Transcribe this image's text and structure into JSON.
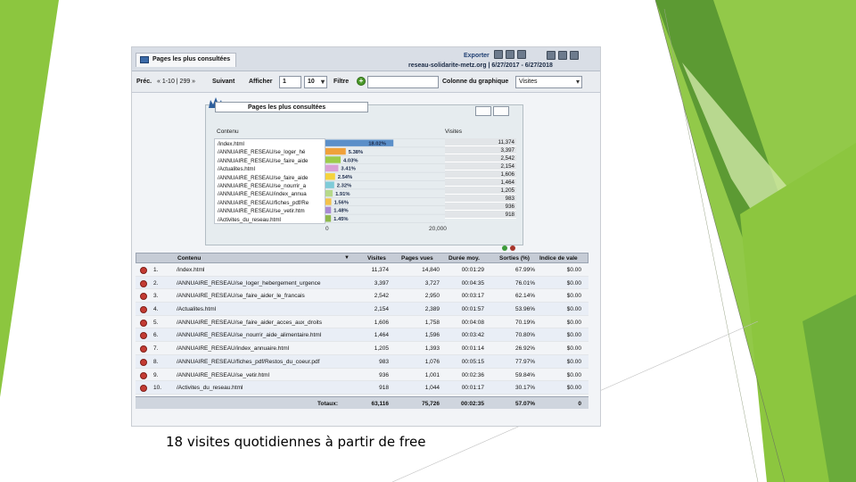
{
  "slide": {
    "caption": "18 visites quotidiennes à partir de free",
    "accent_green": "#8cc63f",
    "dark_green": "#4e8f2e",
    "light_green": "#cfe7a6"
  },
  "toolbar": {
    "tab_label": "Pages les plus consultées",
    "export_label": "Exporter",
    "site_range": "reseau-solidarite-metz.org | 6/27/2017 - 6/27/2018"
  },
  "nav": {
    "prev_label": "Préc.",
    "range_text": "« 1-10 | 299 »",
    "next_label": "Suivant",
    "show_label": "Afficher",
    "page_value": "1",
    "per_page_value": "10",
    "filter_label": "Filtre",
    "filter_value": "",
    "chart_column_label": "Colonne du graphique",
    "chart_column_value": "Visites"
  },
  "chart": {
    "title": "Pages les plus consultées",
    "col_content": "Contenu",
    "col_visits": "Visites",
    "ticks": [
      "0",
      "20,000"
    ]
  },
  "chart_data": {
    "type": "bar",
    "title": "Pages les plus consultées",
    "xlim": [
      0,
      20000
    ],
    "categories": [
      "/index.html",
      "/ANNUAIRE_RESEAU/se_loger_hé",
      "/ANNUAIRE_RESEAU/se_faire_aide",
      "/Actualites.html",
      "/ANNUAIRE_RESEAU/se_faire_aide",
      "/ANNUAIRE_RESEAU/se_nourrir_a",
      "/ANNUAIRE_RESEAU/index_annua",
      "/ANNUAIRE_RESEAU/fiches_pdf/Re",
      "/ANNUAIRE_RESEAU/se_vetir.htm",
      "/Activites_du_reseau.html"
    ],
    "values": [
      11374,
      3397,
      2542,
      2154,
      1606,
      1464,
      1205,
      983,
      936,
      918
    ],
    "percent_labels": [
      "18.02%",
      "5.38%",
      "4.03%",
      "3.41%",
      "2.54%",
      "2.32%",
      "1.91%",
      "1.56%",
      "1.48%",
      "1.45%"
    ],
    "value_labels": [
      "11,374",
      "3,397",
      "2,542",
      "2,154",
      "1,606",
      "1,464",
      "1,205",
      "983",
      "936",
      "918"
    ],
    "colors": [
      "#5b8fc9",
      "#f0a13a",
      "#9ccc4a",
      "#d9a0d6",
      "#f5d33c",
      "#7fcbd8",
      "#b6d98a",
      "#f3c24a",
      "#a98ad4",
      "#8fb84d"
    ]
  },
  "table": {
    "headers": [
      "Contenu",
      "Visites",
      "Pages vues",
      "Durée moy.",
      "Sorties (%)",
      "Indice de vale"
    ],
    "rows": [
      {
        "idx": "1.",
        "content": "/index.html",
        "visits": "11,374",
        "views": "14,840",
        "duration": "00:01:29",
        "exits": "67.99%",
        "value": "$0.00"
      },
      {
        "idx": "2.",
        "content": "/ANNUAIRE_RESEAU/se_loger_hebergement_urgence",
        "visits": "3,397",
        "views": "3,727",
        "duration": "00:04:35",
        "exits": "76.01%",
        "value": "$0.00"
      },
      {
        "idx": "3.",
        "content": "/ANNUAIRE_RESEAU/se_faire_aider_le_francais",
        "visits": "2,542",
        "views": "2,950",
        "duration": "00:03:17",
        "exits": "62.14%",
        "value": "$0.00"
      },
      {
        "idx": "4.",
        "content": "/Actualites.html",
        "visits": "2,154",
        "views": "2,389",
        "duration": "00:01:57",
        "exits": "53.96%",
        "value": "$0.00"
      },
      {
        "idx": "5.",
        "content": "/ANNUAIRE_RESEAU/se_faire_aider_acces_aux_droits",
        "visits": "1,606",
        "views": "1,758",
        "duration": "00:04:08",
        "exits": "70.19%",
        "value": "$0.00"
      },
      {
        "idx": "6.",
        "content": "/ANNUAIRE_RESEAU/se_nourrir_aide_alimentaire.html",
        "visits": "1,464",
        "views": "1,596",
        "duration": "00:03:42",
        "exits": "70.80%",
        "value": "$0.00"
      },
      {
        "idx": "7.",
        "content": "/ANNUAIRE_RESEAU/index_annuaire.html",
        "visits": "1,205",
        "views": "1,393",
        "duration": "00:01:14",
        "exits": "26.92%",
        "value": "$0.00"
      },
      {
        "idx": "8.",
        "content": "/ANNUAIRE_RESEAU/fiches_pdf/Restos_du_coeur.pdf",
        "visits": "983",
        "views": "1,076",
        "duration": "00:05:15",
        "exits": "77.97%",
        "value": "$0.00"
      },
      {
        "idx": "9.",
        "content": "/ANNUAIRE_RESEAU/se_vetir.html",
        "visits": "936",
        "views": "1,001",
        "duration": "00:02:36",
        "exits": "59.84%",
        "value": "$0.00"
      },
      {
        "idx": "10.",
        "content": "/Activites_du_reseau.html",
        "visits": "918",
        "views": "1,044",
        "duration": "00:01:17",
        "exits": "30.17%",
        "value": "$0.00"
      }
    ],
    "totals": {
      "label": "Totaux:",
      "visits": "63,116",
      "views": "75,726",
      "duration": "00:02:35",
      "exits": "57.07%",
      "value": "0"
    }
  }
}
